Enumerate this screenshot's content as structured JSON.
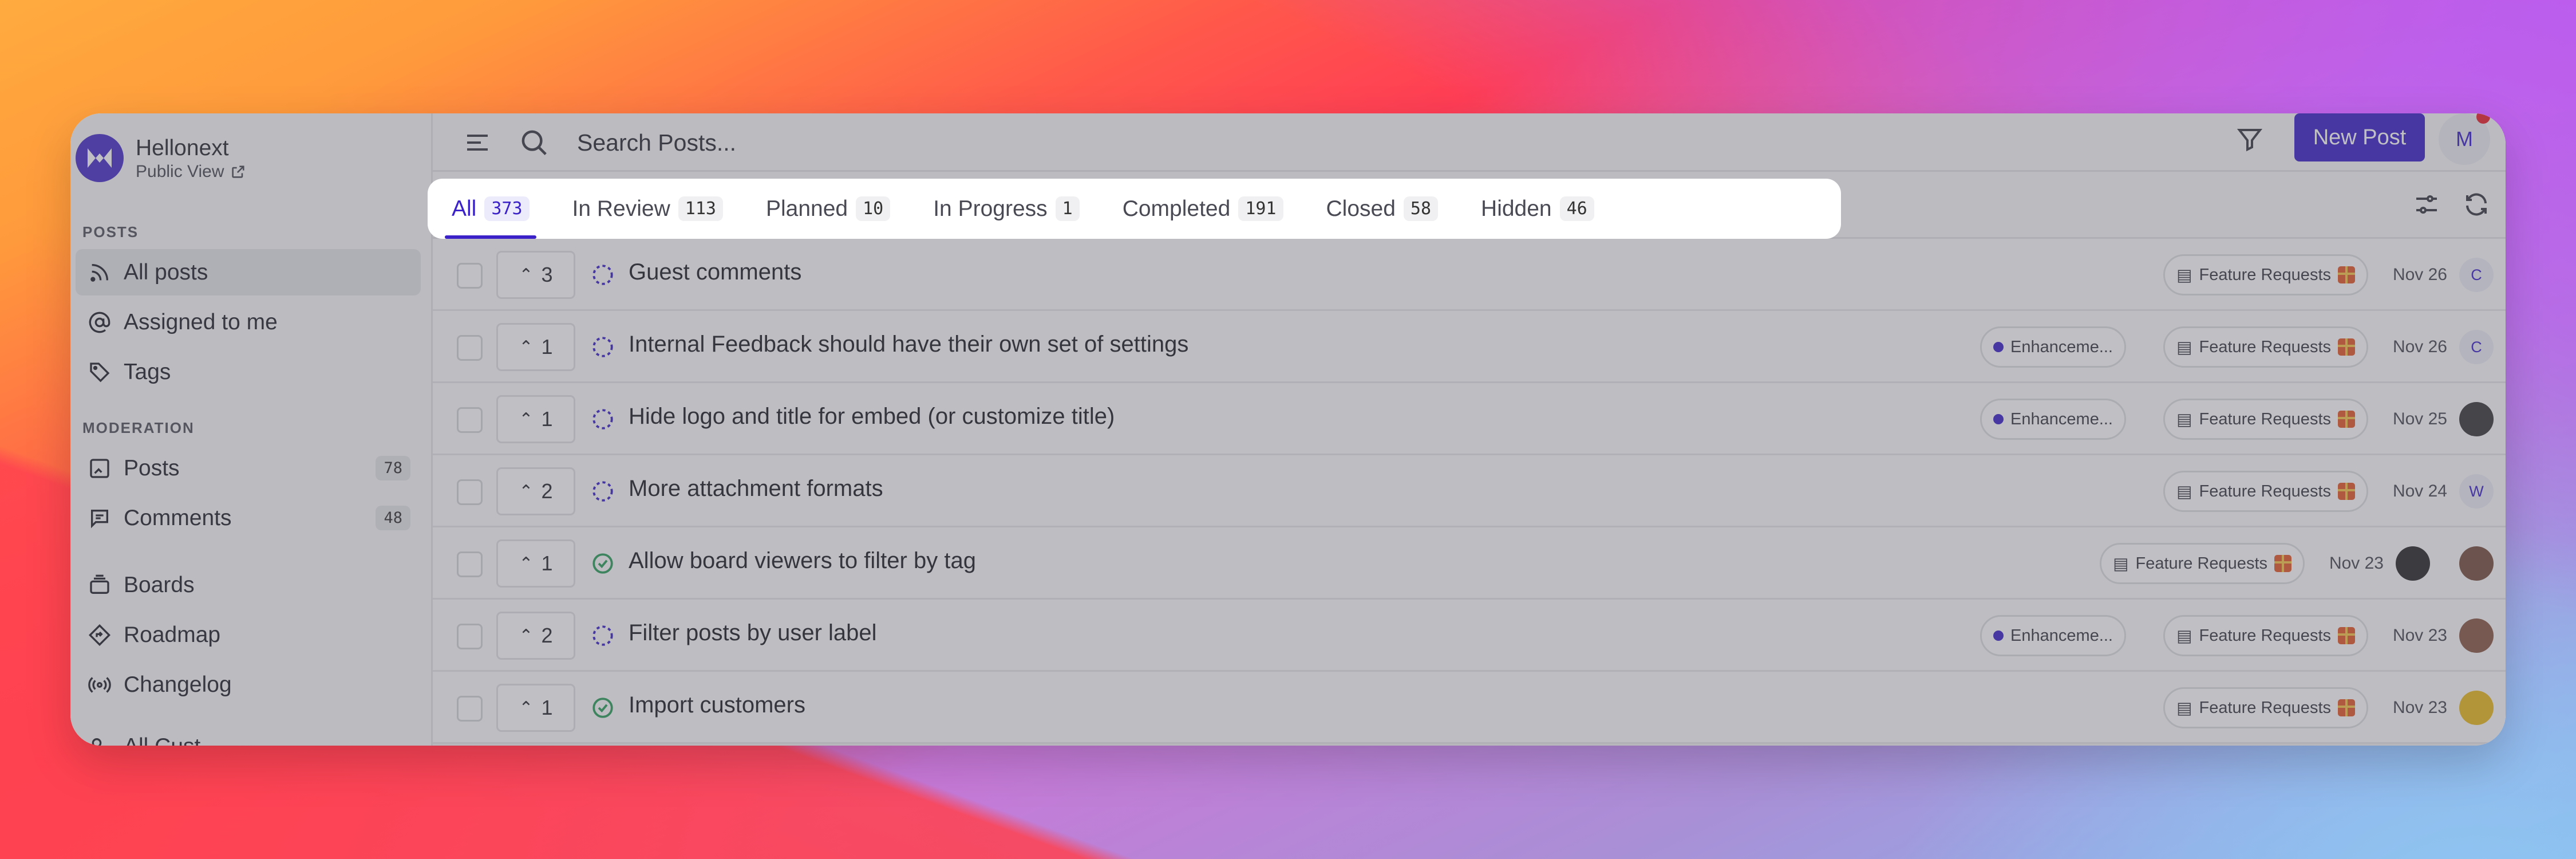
{
  "app": {
    "name": "Hellonext",
    "public_view": "Public View"
  },
  "sidebar": {
    "sections": {
      "posts": "POSTS",
      "moderation": "MODERATION"
    },
    "posts_items": [
      {
        "label": "All posts",
        "icon": "rss-icon"
      },
      {
        "label": "Assigned to me",
        "icon": "at-icon"
      },
      {
        "label": "Tags",
        "icon": "tag-icon"
      }
    ],
    "moderation_items": [
      {
        "label": "Posts",
        "icon": "inbox-post-icon",
        "count": "78"
      },
      {
        "label": "Comments",
        "icon": "comment-icon",
        "count": "48"
      }
    ],
    "other_items": [
      {
        "label": "Boards",
        "icon": "boards-icon"
      },
      {
        "label": "Roadmap",
        "icon": "roadmap-icon"
      },
      {
        "label": "Changelog",
        "icon": "broadcast-icon"
      },
      {
        "label": "All Cust...",
        "icon": "customers-icon"
      }
    ]
  },
  "header": {
    "search_placeholder": "Search Posts...",
    "new_post": "New Post",
    "avatar_initial": "M"
  },
  "tabs": [
    {
      "label": "All",
      "count": "373"
    },
    {
      "label": "In Review",
      "count": "113"
    },
    {
      "label": "Planned",
      "count": "10"
    },
    {
      "label": "In Progress",
      "count": "1"
    },
    {
      "label": "Completed",
      "count": "191"
    },
    {
      "label": "Closed",
      "count": "58"
    },
    {
      "label": "Hidden",
      "count": "46"
    }
  ],
  "posts": [
    {
      "votes": "3",
      "title": "Guest comments",
      "status": "in-review",
      "tags": [],
      "board": "Feature Requests",
      "date": "Nov 26",
      "avatar": "C"
    },
    {
      "votes": "1",
      "title": "Internal Feedback should have their own set of settings",
      "status": "in-review",
      "tags": [
        "Enhanceme..."
      ],
      "board": "Feature Requests",
      "date": "Nov 26",
      "avatar": "C"
    },
    {
      "votes": "1",
      "title": "Hide logo and title for embed (or customize title)",
      "status": "in-review",
      "tags": [
        "Enhanceme..."
      ],
      "board": "Feature Requests",
      "date": "Nov 25",
      "avatar": ""
    },
    {
      "votes": "2",
      "title": "More attachment formats",
      "status": "in-review",
      "tags": [],
      "board": "Feature Requests",
      "date": "Nov 24",
      "avatar": "W"
    },
    {
      "votes": "1",
      "title": "Allow board viewers to filter by tag",
      "status": "completed",
      "tags": [],
      "board": "Feature Requests",
      "date": "Nov 23",
      "avatar": ""
    },
    {
      "votes": "2",
      "title": "Filter posts by user label",
      "status": "in-review",
      "tags": [
        "Enhanceme..."
      ],
      "board": "Feature Requests",
      "date": "Nov 23",
      "avatar": ""
    },
    {
      "votes": "1",
      "title": "Import customers",
      "status": "completed",
      "tags": [],
      "board": "Feature Requests",
      "date": "Nov 23",
      "avatar": ""
    }
  ],
  "colors": {
    "accent": "#3a22c8",
    "notification": "#e8222e",
    "completed": "#2e9e5b"
  }
}
